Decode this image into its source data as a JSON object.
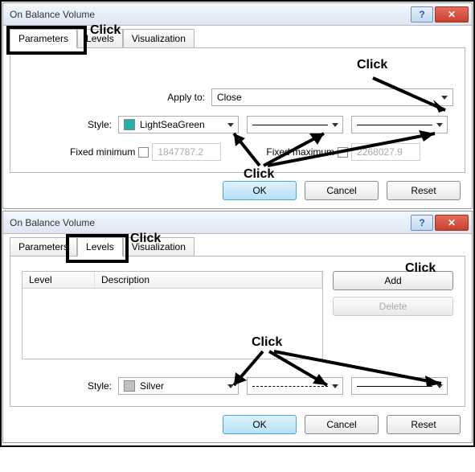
{
  "dialog1": {
    "title": "On Balance Volume",
    "tabs": {
      "parameters": "Parameters",
      "levels": "Levels",
      "visualization": "Visualization"
    },
    "applyto_label": "Apply to:",
    "applyto_value": "Close",
    "style_label": "Style:",
    "style_color_name": "LightSeaGreen",
    "style_color_hex": "#20B2AA",
    "fixed_min_label": "Fixed minimum",
    "fixed_min_value": "1847787.2",
    "fixed_max_label": "Fixed maximum",
    "fixed_max_value": "2268027.9",
    "buttons": {
      "ok": "OK",
      "cancel": "Cancel",
      "reset": "Reset"
    },
    "annotations": {
      "click_top": "Click",
      "click_bottom": "Click",
      "click_right": "Click"
    }
  },
  "dialog2": {
    "title": "On Balance Volume",
    "tabs": {
      "parameters": "Parameters",
      "levels": "Levels",
      "visualization": "Visualization"
    },
    "list": {
      "col_level": "Level",
      "col_desc": "Description"
    },
    "add_label": "Add",
    "delete_label": "Delete",
    "style_label": "Style:",
    "style_color_name": "Silver",
    "style_color_hex": "#C0C0C0",
    "buttons": {
      "ok": "OK",
      "cancel": "Cancel",
      "reset": "Reset"
    },
    "annotations": {
      "click_top": "Click",
      "click_mid": "Click",
      "click_right": "Click"
    }
  }
}
